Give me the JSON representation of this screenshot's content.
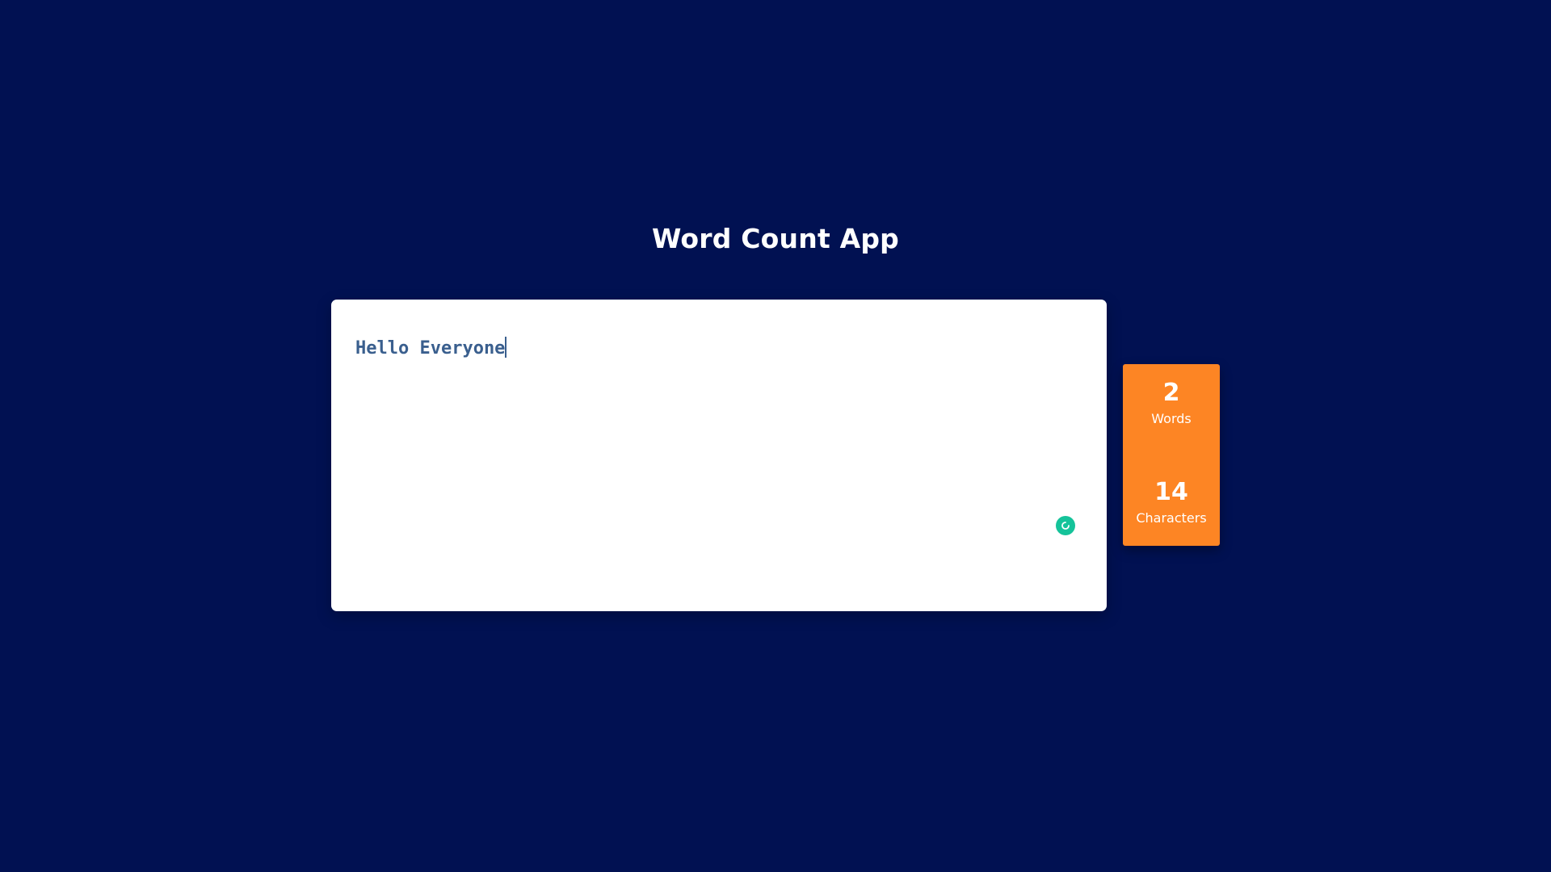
{
  "app": {
    "title": "Word Count App"
  },
  "editor": {
    "text": "Hello Everyone",
    "grammar_badge_icon": "grammar-assistant-icon"
  },
  "stats": {
    "words": {
      "value": "2",
      "label": "Words"
    },
    "characters": {
      "value": "14",
      "label": "Characters"
    }
  },
  "colors": {
    "background": "#011152",
    "card": "#ffffff",
    "accent": "#fd8524",
    "text_in_editor": "#3a5f8e",
    "badge": "#15c39a"
  }
}
